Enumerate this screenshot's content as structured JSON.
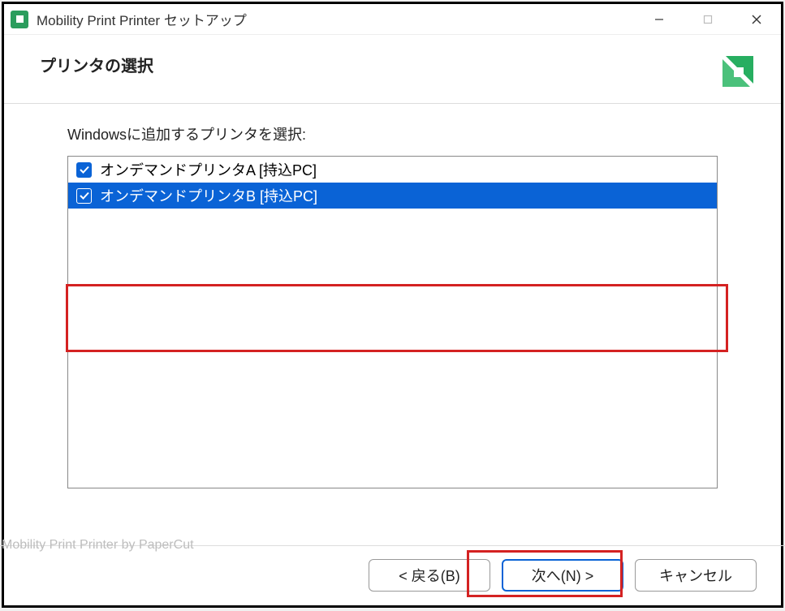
{
  "titlebar": {
    "icon_name": "papercut-app-icon",
    "title": "Mobility Print Printer セットアップ"
  },
  "header": {
    "title": "プリンタの選択",
    "logo_name": "papercut-logo"
  },
  "content": {
    "instruction": "Windowsに追加するプリンタを選択:",
    "printers": [
      {
        "label": "オンデマンドプリンタA [持込PC]",
        "checked": true,
        "selected": false
      },
      {
        "label": "オンデマンドプリンタB [持込PC]",
        "checked": true,
        "selected": true
      }
    ]
  },
  "footer": {
    "brand": "Mobility Print Printer by PaperCut",
    "back_label": "< 戻る(B)",
    "next_label": "次へ(N) >",
    "cancel_label": "キャンセル"
  }
}
